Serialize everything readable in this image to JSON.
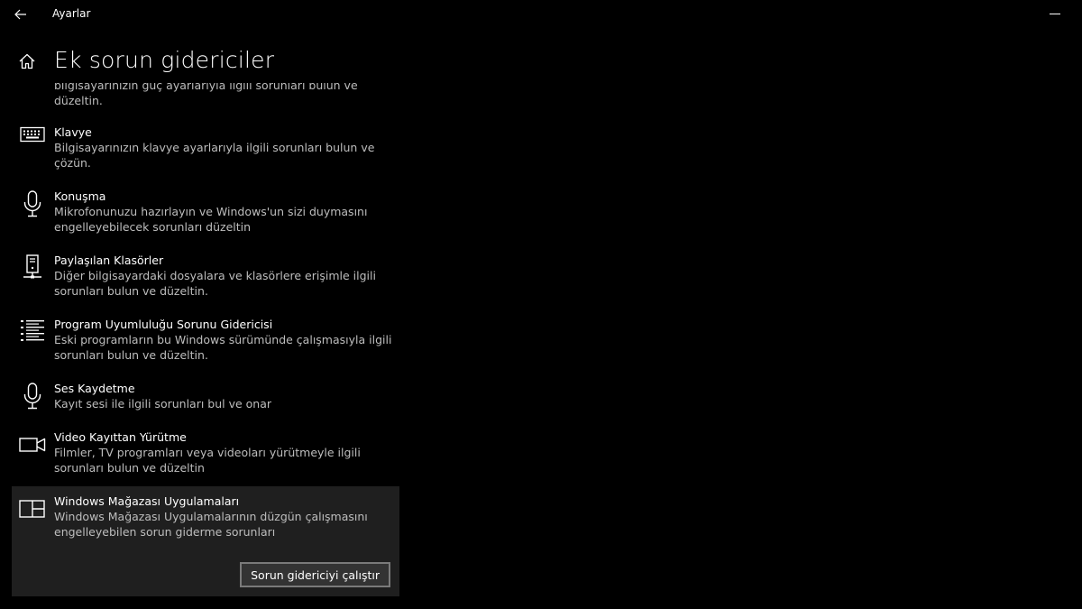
{
  "window": {
    "title": "Ayarlar"
  },
  "icons": {
    "back": "back-arrow-icon",
    "home": "home-icon",
    "minimize": "minimize-icon"
  },
  "page": {
    "title": "Ek sorun gidericiler"
  },
  "items": [
    {
      "name": "",
      "description": "bilgisayarınızın güç ayarlarıyla ilgili sorunları bulun ve düzeltin.",
      "icon": "power-icon"
    },
    {
      "name": "Klavye",
      "description": "Bilgisayarınızın klavye ayarlarıyla ilgili sorunları bulun ve çözün.",
      "icon": "keyboard-icon"
    },
    {
      "name": "Konuşma",
      "description": "Mikrofonunuzu hazırlayın ve Windows'un sizi duymasını engelleyebilecek sorunları düzeltin",
      "icon": "microphone-icon"
    },
    {
      "name": "Paylaşılan Klasörler",
      "description": "Diğer bilgisayardaki dosyalara ve klasörlere erişimle ilgili sorunları bulun ve düzeltin.",
      "icon": "network-computer-icon"
    },
    {
      "name": "Program Uyumluluğu Sorunu Gidericisi",
      "description": "Eski programların bu Windows sürümünde çalışmasıyla ilgili sorunları bulun ve düzeltin.",
      "icon": "list-icon"
    },
    {
      "name": "Ses Kaydetme",
      "description": "Kayıt sesi ile ilgili sorunları bul ve onar",
      "icon": "microphone-icon"
    },
    {
      "name": "Video Kayıttan Yürütme",
      "description": "Filmler, TV programları veya videoları yürütmeyle ilgili sorunları bulun ve düzeltin",
      "icon": "video-camera-icon"
    },
    {
      "name": "Windows Mağazası Uygulamaları",
      "description": "Windows Mağazası Uygulamalarının düzgün çalışmasını engelleyebilen sorun giderme sorunları",
      "icon": "store-apps-icon",
      "selected": true,
      "button_label": "Sorun gidericiyi çalıştır"
    }
  ],
  "colors": {
    "background": "#000000",
    "selected_background": "#1f1f1f",
    "secondary_text": "#bdbdbd",
    "button_border": "#7a7a7a"
  }
}
